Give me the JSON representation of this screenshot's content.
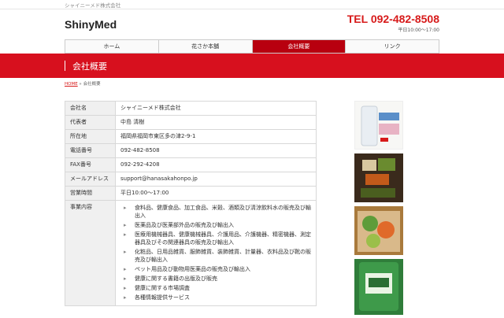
{
  "header": {
    "company_small": "シャイニーメド株式会社",
    "logo": "ShinyMed",
    "tel": "TEL 092-482-8508",
    "hours": "平日10:00〜17:00"
  },
  "nav": [
    {
      "label": "ホーム",
      "active": false
    },
    {
      "label": "花さか本舗",
      "active": false
    },
    {
      "label": "会社概要",
      "active": true
    },
    {
      "label": "リンク",
      "active": false
    }
  ],
  "page_title": "会社概要",
  "breadcrumb": {
    "home": "HOME",
    "sep": " » ",
    "current": "会社概要"
  },
  "table": [
    {
      "k": "会社名",
      "v": "シャイニーメド株式会社"
    },
    {
      "k": "代表者",
      "v": "中島 清樹"
    },
    {
      "k": "所在地",
      "v": "福岡県福岡市東区多の津2-9-1"
    },
    {
      "k": "電話番号",
      "v": "092-482-8508"
    },
    {
      "k": "FAX番号",
      "v": "092-292-4208"
    },
    {
      "k": "メールアドレス",
      "v": "support@hanasakahonpo.jp"
    },
    {
      "k": "営業時間",
      "v": "平日10:00〜17:00"
    }
  ],
  "business": {
    "label": "事業内容",
    "items": [
      "食料品、健康食品、加工食品、米穀、酒類及び清涼飲料水の販売及び輸出入",
      "医薬品及び医薬部外品の販売及び輸出入",
      "医療用機械器具、健康機械器具、介護用品、介護機器、精密機器、測定器具及びその関連器具の販売及び輸出入",
      "化粧品、日用品雑貨、服飾雑貨、装飾雑貨、計量器、衣料品及び靴の販売及び輸出入",
      "ペット用品及び動物用医薬品の販売及び輸出入",
      "健康に関する書籍の出版及び販売",
      "健康に関する市場調査",
      "各種情報提供サービス"
    ]
  }
}
